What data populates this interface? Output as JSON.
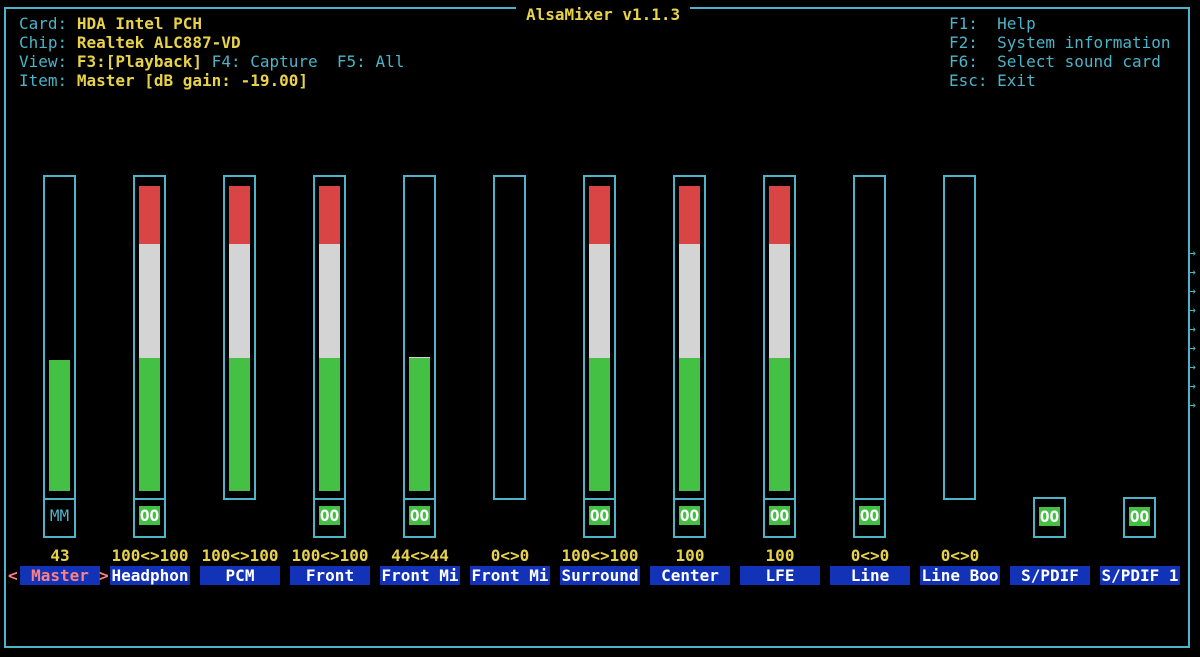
{
  "window": {
    "title": "AlsaMixer v1.1.3"
  },
  "info": {
    "card_label": "Card:",
    "card_value": "HDA Intel PCH",
    "chip_label": "Chip:",
    "chip_value": "Realtek ALC887-VD",
    "view_label": "View:",
    "view_playback": "F3:[Playback]",
    "view_capture": " F4: Capture",
    "view_all": "  F5: All",
    "item_label": "Item:",
    "item_value": "Master [dB gain: -19.00]"
  },
  "keys": [
    "F1:  Help",
    "F2:  System information",
    "F6:  Select sound card",
    "Esc: Exit"
  ],
  "channels": [
    {
      "name": " Master ",
      "value": "43",
      "switch": "MM",
      "level": 0.43,
      "selected": true
    },
    {
      "name": "Headphon",
      "value": "100<>100",
      "switch": "OO",
      "level": 1.0
    },
    {
      "name": "PCM",
      "value": "100<>100",
      "switch": "",
      "level": 1.0
    },
    {
      "name": "Front",
      "value": "100<>100",
      "switch": "OO",
      "level": 1.0
    },
    {
      "name": "Front Mi",
      "value": "44<>44",
      "switch": "OO",
      "level": 0.44
    },
    {
      "name": "Front Mi",
      "value": "0<>0",
      "switch": "",
      "level": 0
    },
    {
      "name": "Surround",
      "value": "100<>100",
      "switch": "OO",
      "level": 1.0
    },
    {
      "name": "Center",
      "value": "100",
      "switch": "OO",
      "level": 1.0
    },
    {
      "name": "LFE",
      "value": "100",
      "switch": "OO",
      "level": 1.0
    },
    {
      "name": "Line",
      "value": "0<>0",
      "switch": "OO",
      "level": 0
    },
    {
      "name": "Line Boo",
      "value": "0<>0",
      "switch": "",
      "level": 0
    },
    {
      "name": "S/PDIF",
      "value": "",
      "switch": "OO",
      "level": null
    },
    {
      "name": "S/PDIF 1",
      "value": "",
      "switch": "OO",
      "level": null
    }
  ],
  "nav": {
    "left_arrow": "<",
    "right_arrow": ">"
  },
  "scroll_arrows": [
    "→",
    "→",
    "→",
    "→",
    "→",
    "→",
    "→",
    "→",
    "→"
  ],
  "colors": {
    "border": "#4db3c8",
    "label": "#e8d24a",
    "green": "#44c144",
    "white": "#d4d4d4",
    "red": "#d94444",
    "name_bg": "#1232b8",
    "selected": "#ff8080"
  }
}
